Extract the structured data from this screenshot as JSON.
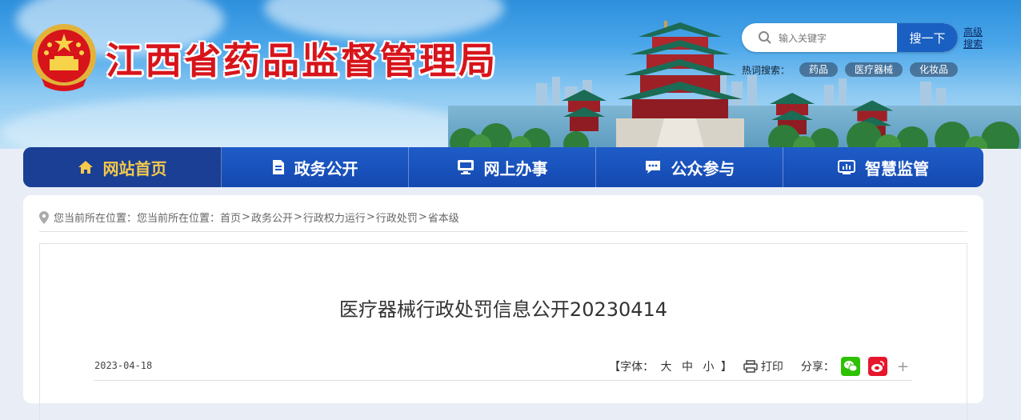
{
  "header": {
    "site_title": "江西省药品监督管理局",
    "search": {
      "placeholder": "输入关键字",
      "button_label": "搜一下",
      "advanced_label": "高级搜索"
    },
    "hotwords": {
      "label": "热词搜索：",
      "items": [
        "药品",
        "医疗器械",
        "化妆品"
      ]
    }
  },
  "nav": {
    "items": [
      {
        "label": "网站首页",
        "icon": "home-icon",
        "active": true
      },
      {
        "label": "政务公开",
        "icon": "document-icon",
        "active": false
      },
      {
        "label": "网上办事",
        "icon": "monitor-icon",
        "active": false
      },
      {
        "label": "公众参与",
        "icon": "chat-icon",
        "active": false
      },
      {
        "label": "智慧监管",
        "icon": "dashboard-icon",
        "active": false
      }
    ]
  },
  "breadcrumb": {
    "prefix": "您当前所在位置：",
    "prefix2": "您当前所在位置：",
    "items": [
      "首页",
      "政务公开",
      "行政权力运行",
      "行政处罚",
      "省本级"
    ],
    "separator": ">"
  },
  "article": {
    "title": "医疗器械行政处罚信息公开20230414",
    "date": "2023-04-18",
    "font_size": {
      "label_open": "【字体：",
      "large": "大",
      "medium": "中",
      "small": "小",
      "label_close": "】"
    },
    "print_label": "打印",
    "share_label": "分享：",
    "more_label": "+"
  },
  "colors": {
    "nav_bg": "#1a55c0",
    "nav_active_bg": "#1a3f94",
    "nav_active_text": "#f5c94b",
    "title_red": "#d8141b",
    "wechat": "#2dc100",
    "weibo": "#e6162d"
  }
}
